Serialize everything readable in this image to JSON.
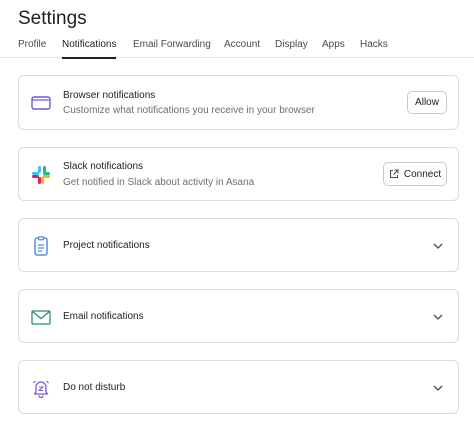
{
  "page_title": "Settings",
  "tabs": [
    {
      "label": "Profile",
      "active": false
    },
    {
      "label": "Notifications",
      "active": true
    },
    {
      "label": "Email Forwarding",
      "active": false
    },
    {
      "label": "Account",
      "active": false
    },
    {
      "label": "Display",
      "active": false
    },
    {
      "label": "Apps",
      "active": false
    },
    {
      "label": "Hacks",
      "active": false
    }
  ],
  "cards": {
    "browser": {
      "title": "Browser notifications",
      "description": "Customize what notifications you receive in your browser",
      "button": "Allow",
      "icon": "browser-window-icon"
    },
    "slack": {
      "title": "Slack notifications",
      "description": "Get notified in Slack about activity in Asana",
      "button": "Connect",
      "icon": "slack-logo-icon"
    },
    "project": {
      "title": "Project notifications",
      "icon": "clipboard-icon"
    },
    "email": {
      "title": "Email notifications",
      "icon": "envelope-icon"
    },
    "dnd": {
      "title": "Do not disturb",
      "icon": "bell-snooze-icon"
    }
  },
  "colors": {
    "browser_icon": "#6d5ad8",
    "project_icon": "#3f7fd6",
    "email_icon": "#2f8f63",
    "dnd_icon": "#7b5bd6",
    "active_tab_underline": "#1e1f21"
  }
}
